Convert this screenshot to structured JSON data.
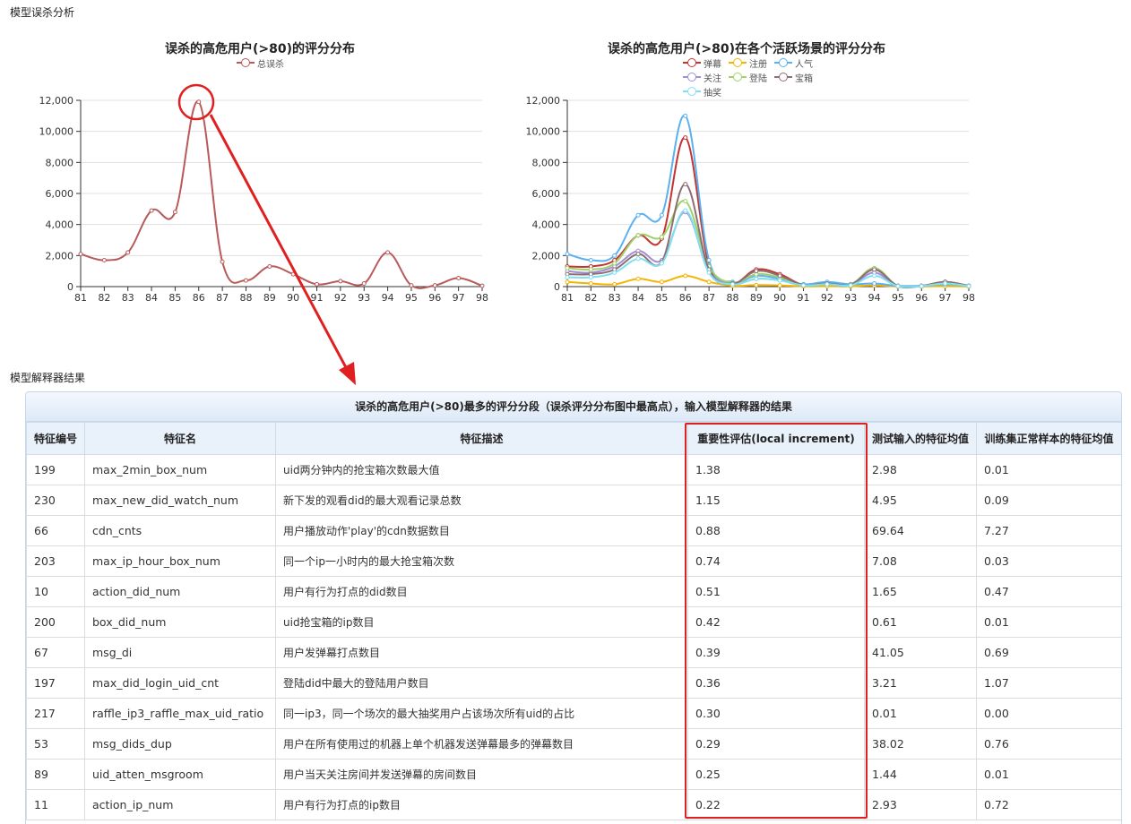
{
  "section1_label": "模型误杀分析",
  "section2_label": "模型解释器结果",
  "chart1": {
    "title": "误杀的高危用户(>80)的评分分布",
    "legend": [
      {
        "name": "总误杀",
        "color": "#b85a5a"
      }
    ]
  },
  "chart2": {
    "title": "误杀的高危用户(>80)在各个活跃场景的评分分布",
    "legend": [
      {
        "name": "弹幕",
        "color": "#c23531"
      },
      {
        "name": "注册",
        "color": "#f4b400"
      },
      {
        "name": "人气",
        "color": "#5ab1ef"
      },
      {
        "name": "关注",
        "color": "#a08fd6"
      },
      {
        "name": "登陆",
        "color": "#9fd26b"
      },
      {
        "name": "宝箱",
        "color": "#8d6e72"
      },
      {
        "name": "抽奖",
        "color": "#7fe0f0"
      }
    ]
  },
  "chart_data": [
    {
      "type": "line",
      "title": "误杀的高危用户(>80)的评分分布",
      "x": [
        81,
        82,
        83,
        84,
        85,
        86,
        87,
        88,
        89,
        90,
        91,
        92,
        93,
        94,
        95,
        96,
        97,
        98
      ],
      "ylim": [
        0,
        12000
      ],
      "yticks": [
        "0",
        "2,000",
        "4,000",
        "6,000",
        "8,000",
        "10,000",
        "12,000"
      ],
      "series": [
        {
          "name": "总误杀",
          "color": "#b85a5a",
          "values": [
            2100,
            1700,
            2200,
            4900,
            4800,
            11900,
            1600,
            400,
            1300,
            800,
            150,
            350,
            200,
            2200,
            80,
            80,
            550,
            50
          ]
        }
      ],
      "annotation": "circle-at-peak"
    },
    {
      "type": "line",
      "title": "误杀的高危用户(>80)在各个活跃场景的评分分布",
      "x": [
        81,
        82,
        83,
        84,
        85,
        86,
        87,
        88,
        89,
        90,
        91,
        92,
        93,
        94,
        95,
        96,
        97,
        98
      ],
      "ylim": [
        0,
        12000
      ],
      "yticks": [
        "0",
        "2,000",
        "4,000",
        "6,000",
        "8,000",
        "10,000",
        "12,000"
      ],
      "series": [
        {
          "name": "弹幕",
          "color": "#c23531",
          "values": [
            1300,
            1300,
            1700,
            3300,
            3100,
            9600,
            1400,
            200,
            1100,
            800,
            100,
            250,
            150,
            1100,
            50,
            50,
            300,
            50
          ]
        },
        {
          "name": "注册",
          "color": "#f4b400",
          "values": [
            300,
            200,
            150,
            500,
            300,
            700,
            300,
            50,
            100,
            80,
            20,
            30,
            20,
            80,
            10,
            10,
            30,
            10
          ]
        },
        {
          "name": "人气",
          "color": "#5ab1ef",
          "values": [
            2100,
            1700,
            2000,
            4600,
            4600,
            11000,
            1700,
            300,
            700,
            500,
            150,
            300,
            150,
            200,
            50,
            50,
            150,
            50
          ]
        },
        {
          "name": "关注",
          "color": "#a08fd6",
          "values": [
            1000,
            900,
            1300,
            2300,
            1700,
            4800,
            1000,
            200,
            500,
            400,
            80,
            150,
            100,
            900,
            30,
            30,
            250,
            30
          ]
        },
        {
          "name": "登陆",
          "color": "#9fd26b",
          "values": [
            1200,
            1100,
            1500,
            3300,
            3200,
            5500,
            1300,
            250,
            800,
            600,
            100,
            200,
            120,
            1200,
            40,
            40,
            300,
            40
          ]
        },
        {
          "name": "宝箱",
          "color": "#8d6e72",
          "values": [
            800,
            800,
            1100,
            2100,
            1600,
            6600,
            1100,
            200,
            1000,
            700,
            100,
            200,
            100,
            1100,
            40,
            40,
            300,
            40
          ]
        },
        {
          "name": "抽奖",
          "color": "#7fe0f0",
          "values": [
            600,
            600,
            900,
            1800,
            1500,
            4900,
            900,
            150,
            500,
            400,
            80,
            150,
            80,
            700,
            30,
            30,
            200,
            30
          ]
        }
      ]
    }
  ],
  "table": {
    "caption": "误杀的高危用户(>80)最多的评分分段（误杀评分分布图中最高点），输入模型解释器的结果",
    "headers": [
      "特征编号",
      "特征名",
      "特征描述",
      "重要性评估(local increment)",
      "测试输入的特征均值",
      "训练集正常样本的特征均值"
    ],
    "rows": [
      [
        "199",
        "max_2min_box_num",
        "uid两分钟内的抢宝箱次数最大值",
        "1.38",
        "2.98",
        "0.01"
      ],
      [
        "230",
        "max_new_did_watch_num",
        "新下发的观看did的最大观看记录总数",
        "1.15",
        "4.95",
        "0.09"
      ],
      [
        "66",
        "cdn_cnts",
        "用户播放动作'play'的cdn数据数目",
        "0.88",
        "69.64",
        "7.27"
      ],
      [
        "203",
        "max_ip_hour_box_num",
        "同一个ip一小时内的最大抢宝箱次数",
        "0.74",
        "7.08",
        "0.03"
      ],
      [
        "10",
        "action_did_num",
        "用户有行为打点的did数目",
        "0.51",
        "1.65",
        "0.47"
      ],
      [
        "200",
        "box_did_num",
        "uid抢宝箱的ip数目",
        "0.42",
        "0.61",
        "0.01"
      ],
      [
        "67",
        "msg_di",
        "用户发弹幕打点数目",
        "0.39",
        "41.05",
        "0.69"
      ],
      [
        "197",
        "max_did_login_uid_cnt",
        "登陆did中最大的登陆用户数目",
        "0.36",
        "3.21",
        "1.07"
      ],
      [
        "217",
        "raffle_ip3_raffle_max_uid_ratio",
        "同一ip3，同一个场次的最大抽奖用户占该场次所有uid的占比",
        "0.30",
        "0.01",
        "0.00"
      ],
      [
        "53",
        "msg_dids_dup",
        "用户在所有使用过的机器上单个机器发送弹幕最多的弹幕数目",
        "0.29",
        "38.02",
        "0.76"
      ],
      [
        "89",
        "uid_atten_msgroom",
        "用户当天关注房间并发送弹幕的房间数目",
        "0.25",
        "1.44",
        "0.01"
      ],
      [
        "11",
        "action_ip_num",
        "用户有行为打点的ip数目",
        "0.22",
        "2.93",
        "0.72"
      ]
    ]
  }
}
